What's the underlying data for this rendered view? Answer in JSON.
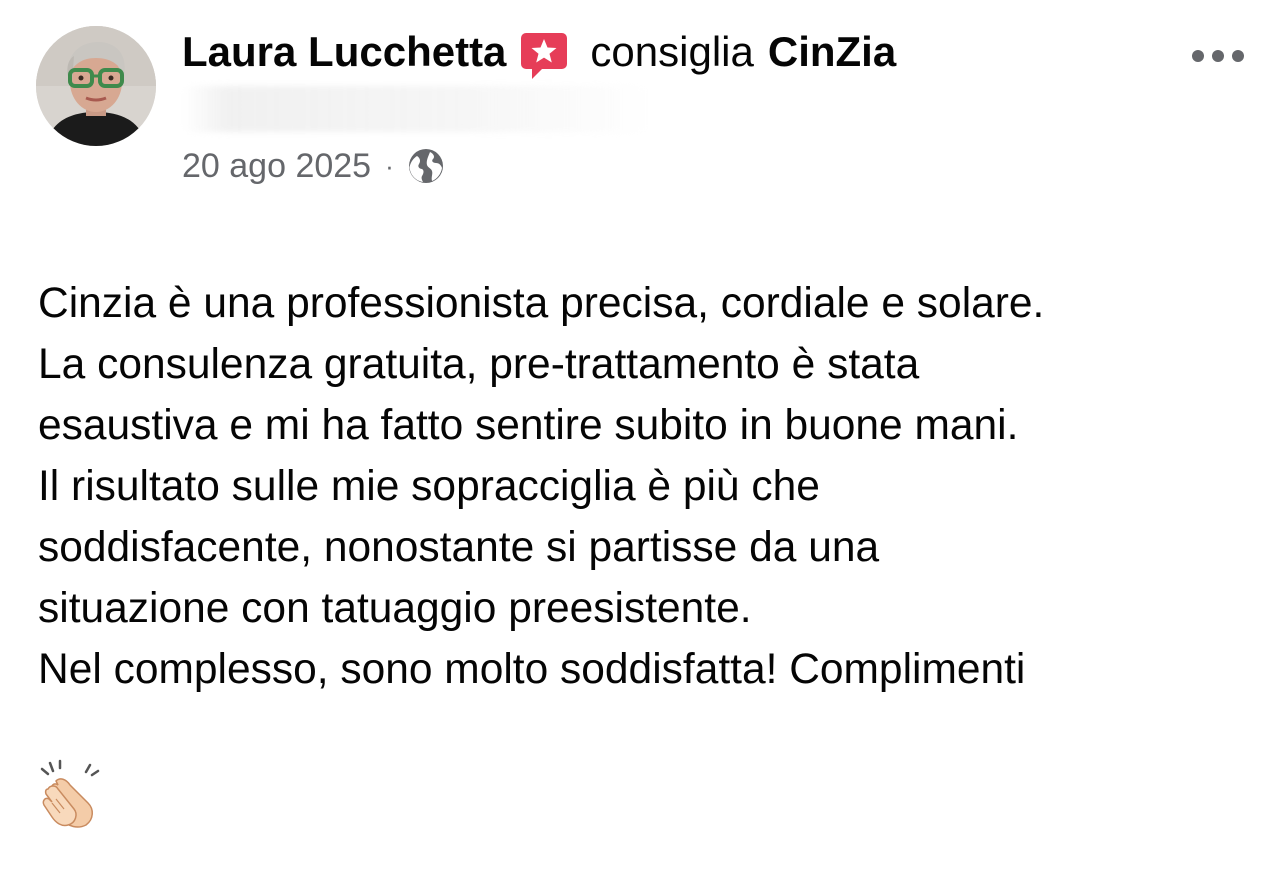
{
  "post": {
    "author": "Laura Lucchetta",
    "verb": "consiglia",
    "page_name": "CinZia",
    "date": "20 ago 2025",
    "separator": "·",
    "privacy_icon": "globe-icon",
    "badge_icon": "recommendation-star-icon",
    "menu_icon": "more-options-icon",
    "text": "Cinzia è una professionista precisa, cordiale e solare.\nLa consulenza gratuita, pre-trattamento è stata\nesaustiva e mi ha fatto sentire subito in buone mani.\nIl risultato sulle mie sopracciglia è più che\nsoddisfacente, nonostante si partisse da una\nsituazione con tatuaggio preesistente.\nNel complesso, sono molto soddisfatta! Complimenti",
    "emoji": "clapping-hands-icon"
  },
  "colors": {
    "text": "#050505",
    "secondary_text": "#65676b",
    "badge": "#e63d58"
  }
}
